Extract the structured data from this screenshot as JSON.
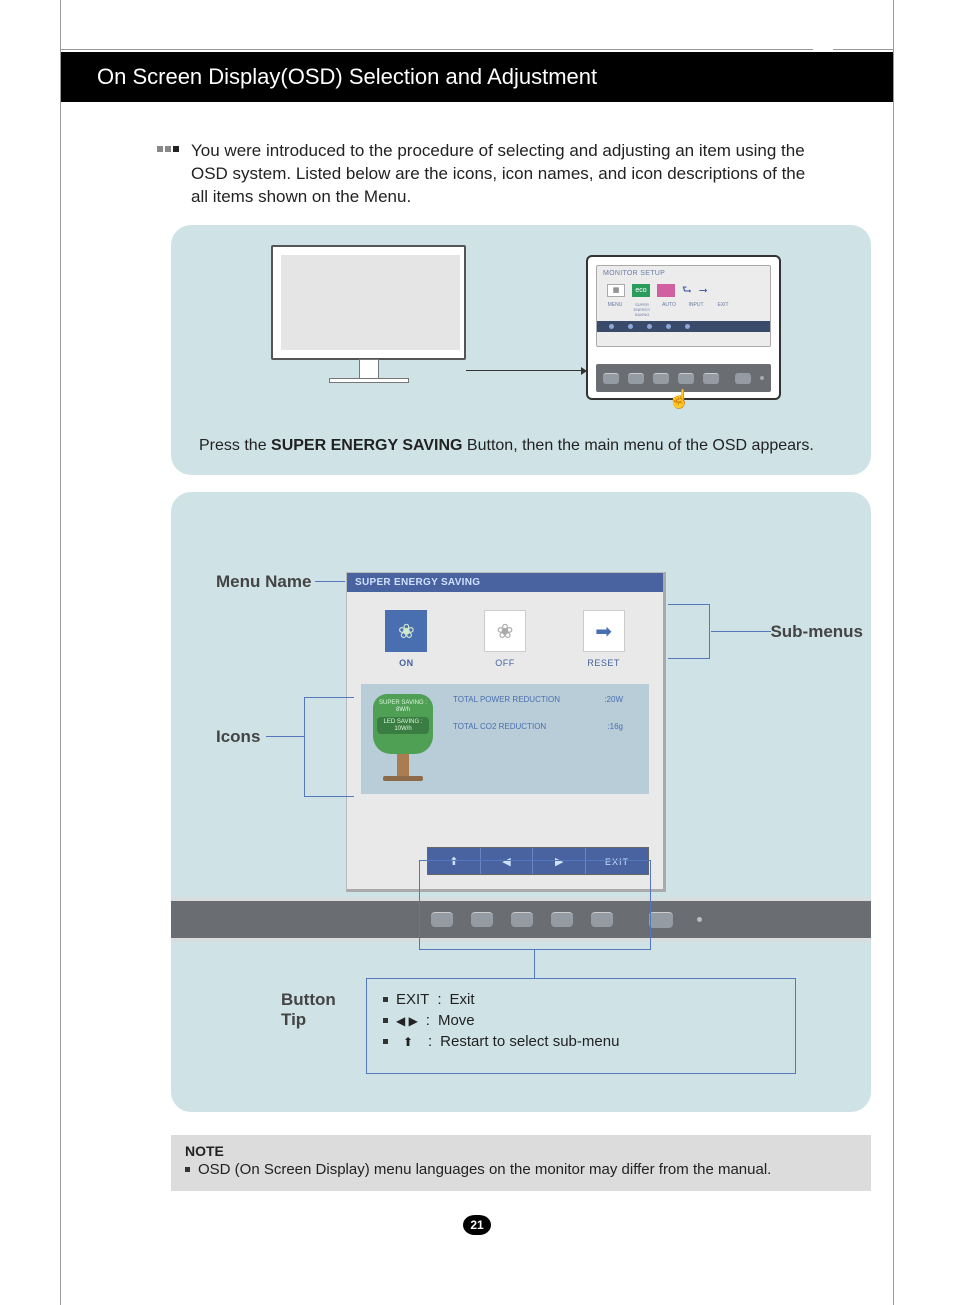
{
  "header": {
    "title": "On Screen Display(OSD) Selection and Adjustment"
  },
  "intro": "You were introduced to the procedure of selecting and adjusting an item using the OSD system. Listed below are the icons, icon names, and icon descriptions of the all items shown on the Menu.",
  "panel1": {
    "caption_prefix": "Press the ",
    "caption_bold": "SUPER ENERGY SAVING",
    "caption_suffix": " Button, then the main menu of the OSD appears.",
    "setup_title": "MONITOR SETUP",
    "setup_labels": [
      "MENU",
      "SUPER ENERGY SAVING",
      "AUTO",
      "INPUT",
      "EXIT"
    ]
  },
  "labels": {
    "menu_name": "Menu Name",
    "icons": "Icons",
    "sub_menus": "Sub-menus",
    "button_tip": "Button Tip"
  },
  "osd": {
    "title": "SUPER ENERGY SAVING",
    "on": "ON",
    "off": "OFF",
    "reset": "RESET",
    "tree_super": "SUPER SAVING : 8W/h",
    "tree_led": "LED SAVING : 10W/h",
    "stat1_label": "TOTAL POWER REDUCTION",
    "stat1_value": ":20W",
    "stat2_label": "TOTAL CO2 REDUCTION",
    "stat2_value": ":16g",
    "nav_exit": "EXIT"
  },
  "tips": {
    "exit_key": "EXIT",
    "exit_desc": "Exit",
    "move_desc": "Move",
    "restart_desc": "Restart to select sub-menu"
  },
  "note": {
    "title": "NOTE",
    "text": "OSD (On Screen Display) menu languages on the monitor may differ from the manual."
  },
  "page_number": "21"
}
